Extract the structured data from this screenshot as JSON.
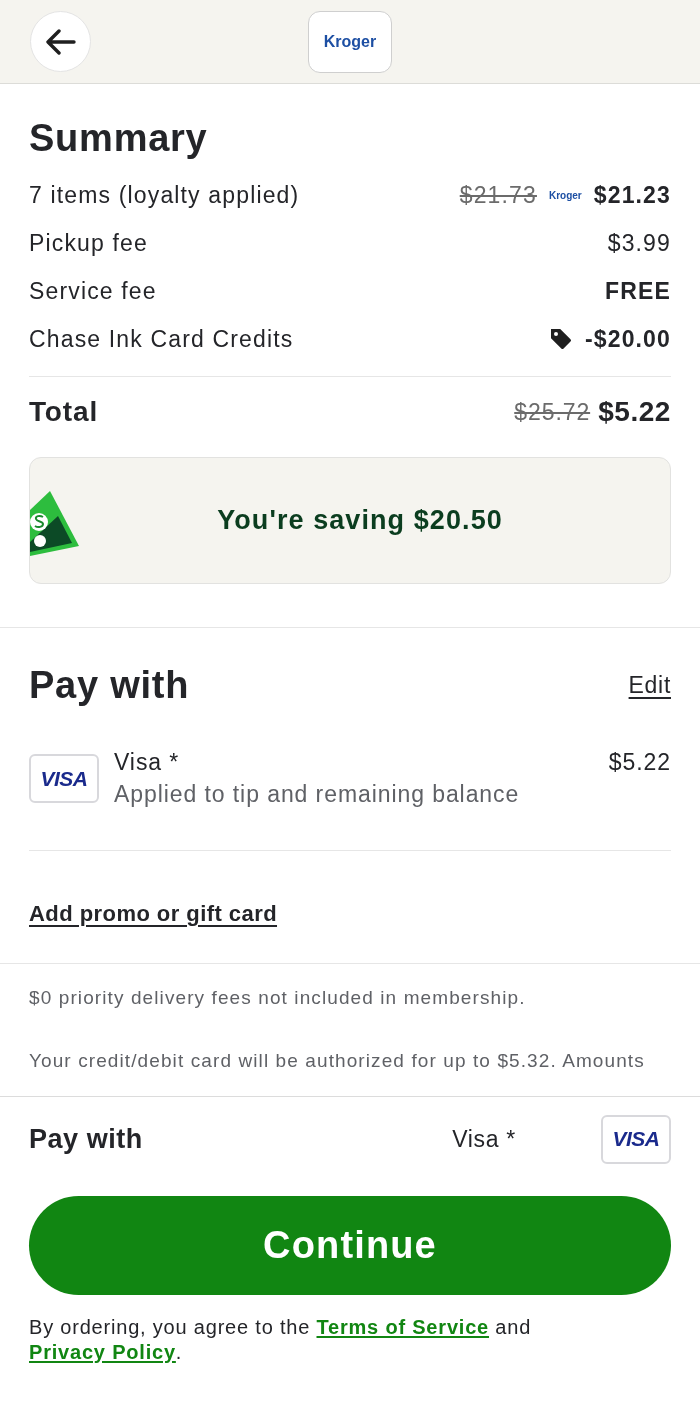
{
  "header": {
    "store_logo": "Kroger"
  },
  "summary": {
    "title": "Summary",
    "rows": [
      {
        "kind": "loyalty",
        "label": "7 items (loyalty applied)",
        "original_price": "$21.73",
        "badge": "Kroger",
        "price": "$21.23",
        "bold": true
      },
      {
        "kind": "fee",
        "label": "Pickup fee",
        "price": "$3.99",
        "bold": false
      },
      {
        "kind": "fee",
        "label": "Service fee",
        "price": "FREE",
        "bold": true
      },
      {
        "kind": "discount",
        "label": "Chase Ink Card Credits",
        "price": "-$20.00",
        "bold": true
      }
    ],
    "total": {
      "label": "Total",
      "original_price": "$25.72",
      "price": "$5.22"
    },
    "savings": {
      "text": "You're saving $20.50"
    }
  },
  "payment": {
    "title": "Pay with",
    "edit_link": "Edit",
    "method": {
      "card_logo": "VISA",
      "name": "Visa *",
      "note": "Applied to tip and remaining balance",
      "amount": "$5.22"
    },
    "promo_link": "Add promo or gift card"
  },
  "notes": [
    "$0 priority delivery fees not included in membership.",
    "Your credit/debit card will be authorized for up to $5.32. Amounts"
  ],
  "footer": {
    "label": "Pay with",
    "method": "Visa *",
    "card_logo": "VISA",
    "button": "Continue",
    "legal": [
      {
        "kind": "text",
        "text": "By ordering, you agree to the "
      },
      {
        "kind": "link",
        "text": "Terms of Service"
      },
      {
        "kind": "text",
        "text": " and "
      },
      {
        "kind": "link",
        "text": "Privacy Policy"
      },
      {
        "kind": "text",
        "text": "."
      }
    ]
  }
}
